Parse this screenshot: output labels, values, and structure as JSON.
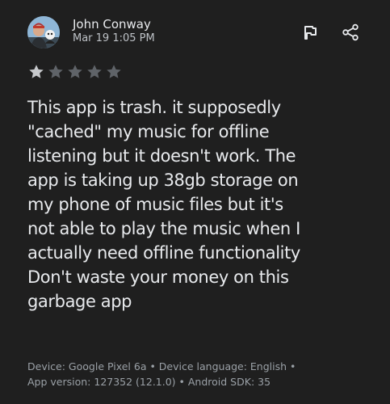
{
  "review": {
    "author": "John Conway",
    "date": "Mar 19 1:05 PM",
    "rating": 1,
    "max_rating": 5,
    "text": "This app is trash. it supposedly\n\"cached\" my music for offline\nlistening but it doesn't work. The\napp is taking up 38gb storage on\nmy phone of music files but it's\nnot able to play the music when I\nactually need offline functionality\nDon't waste your money on this\ngarbage app",
    "device_info": "Device: Google Pixel 6a • Device language: English •\nApp version: 127352 (12.1.0) • Android SDK: 35"
  },
  "icons": {
    "flag": "flag-icon",
    "share": "share-icon",
    "star": "star-icon"
  },
  "colors": {
    "background": "#1f1f1f",
    "text": "#e8eaed",
    "secondary_text": "#bdc1c6",
    "muted_text": "#9aa0a6",
    "star_filled": "#c7c9cc",
    "star_empty": "#5f6368"
  }
}
